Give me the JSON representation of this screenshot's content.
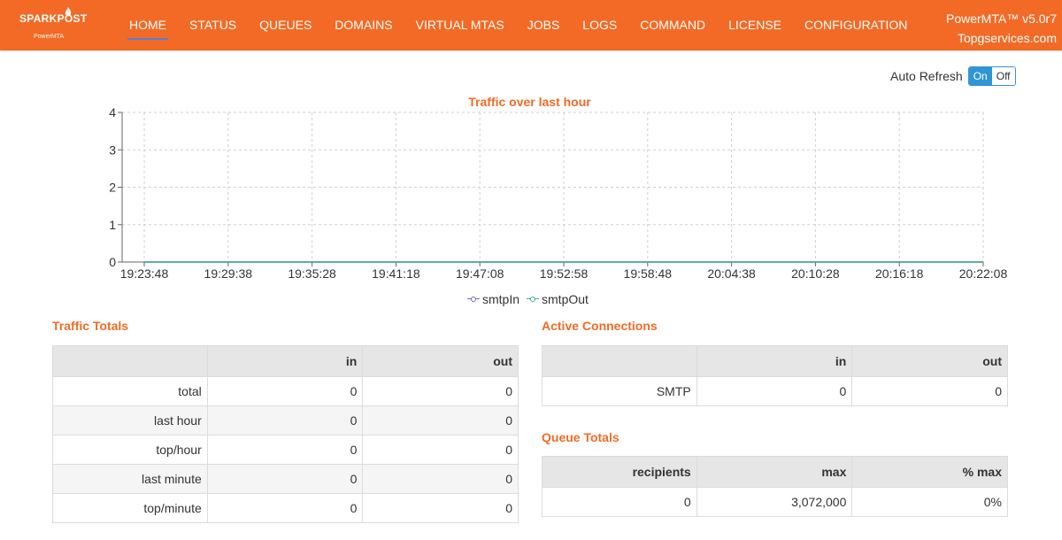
{
  "app": {
    "logo_text": "SPARKPOST",
    "logo_sub": "PowerMTA",
    "version": "PowerMTA™ v5.0r7",
    "host": "Topgservices.com"
  },
  "nav": [
    {
      "label": "HOME",
      "active": true
    },
    {
      "label": "STATUS"
    },
    {
      "label": "QUEUES"
    },
    {
      "label": "DOMAINS"
    },
    {
      "label": "VIRTUAL MTAS"
    },
    {
      "label": "JOBS"
    },
    {
      "label": "LOGS"
    },
    {
      "label": "COMMAND"
    },
    {
      "label": "LICENSE"
    },
    {
      "label": "CONFIGURATION"
    }
  ],
  "auto_refresh": {
    "label": "Auto Refresh",
    "on": "On",
    "off": "Off",
    "state": "On"
  },
  "chart_data": {
    "type": "line",
    "title": "Traffic over last hour",
    "xlabel": "",
    "ylabel": "",
    "ylim": [
      0,
      4
    ],
    "yticks": [
      0,
      1,
      2,
      3,
      4
    ],
    "categories": [
      "19:23:48",
      "19:29:38",
      "19:35:28",
      "19:41:18",
      "19:47:08",
      "19:52:58",
      "19:58:48",
      "20:04:38",
      "20:10:28",
      "20:16:18",
      "20:22:08"
    ],
    "grid": true,
    "legend": "bottom",
    "series": [
      {
        "name": "smtpIn",
        "color": "#7b68c8",
        "values": [
          0,
          0,
          0,
          0,
          0,
          0,
          0,
          0,
          0,
          0,
          0
        ]
      },
      {
        "name": "smtpOut",
        "color": "#3fae8a",
        "values": [
          0,
          0,
          0,
          0,
          0,
          0,
          0,
          0,
          0,
          0,
          0
        ]
      }
    ]
  },
  "traffic_totals": {
    "title": "Traffic Totals",
    "headers": [
      "",
      "in",
      "out"
    ],
    "rows": [
      [
        "total",
        "0",
        "0"
      ],
      [
        "last hour",
        "0",
        "0"
      ],
      [
        "top/hour",
        "0",
        "0"
      ],
      [
        "last minute",
        "0",
        "0"
      ],
      [
        "top/minute",
        "0",
        "0"
      ]
    ]
  },
  "active_connections": {
    "title": "Active Connections",
    "headers": [
      "",
      "in",
      "out"
    ],
    "rows": [
      [
        "SMTP",
        "0",
        "0"
      ]
    ]
  },
  "queue_totals": {
    "title": "Queue Totals",
    "headers": [
      "recipients",
      "max",
      "% max"
    ],
    "rows": [
      [
        "0",
        "3,072,000",
        "0%"
      ]
    ]
  }
}
